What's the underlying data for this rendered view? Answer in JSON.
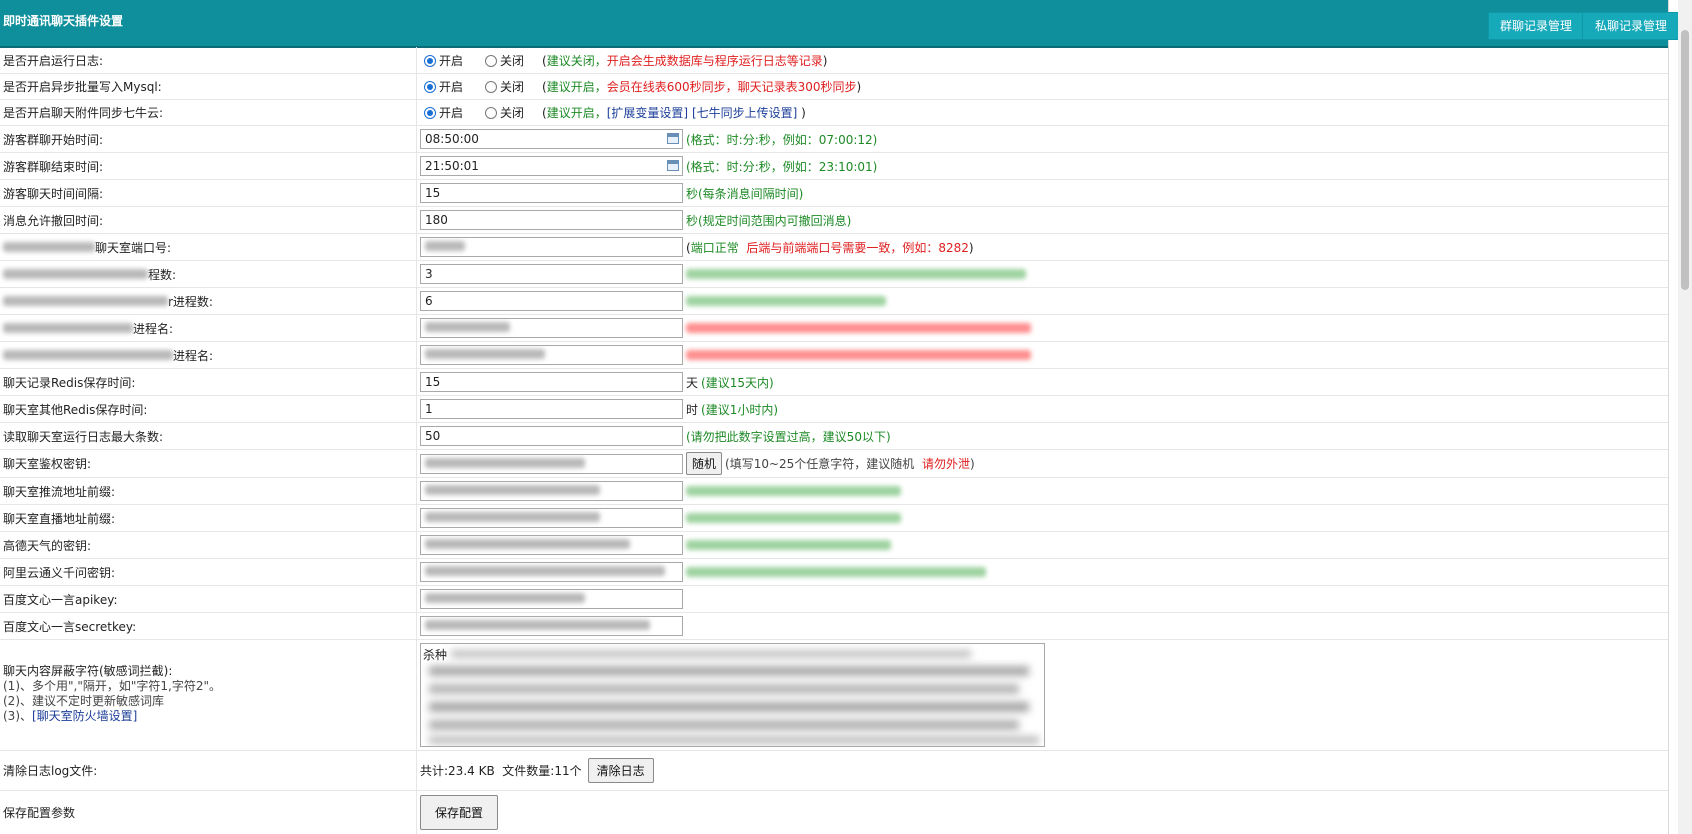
{
  "header": {
    "title": "即时通讯聊天插件设置",
    "btn_group": "群聊记录管理",
    "btn_private": "私聊记录管理"
  },
  "rows": {
    "log": {
      "label": "是否开启运行日志:",
      "on": "开启",
      "off": "关闭",
      "note_open": "(",
      "note_green": "建议关闭，",
      "note_red": "开启会生成数据库与程序运行日志等记录",
      "note_close": ")"
    },
    "mysql": {
      "label": "是否开启异步批量写入Mysql:",
      "on": "开启",
      "off": "关闭",
      "note_open": "(",
      "note_green": "建议开启，",
      "note_red": "会员在线表600秒同步，聊天记录表300秒同步",
      "note_close": ")"
    },
    "qiniu": {
      "label": "是否开启聊天附件同步七牛云:",
      "on": "开启",
      "off": "关闭",
      "note_open": "(",
      "note_green": "建议开启，",
      "link1": "[扩展变量设置]",
      "link2": "[七牛同步上传设置]",
      "note_close": ")"
    },
    "start": {
      "label": "游客群聊开始时间:",
      "value": "08:50:00",
      "note": "(格式：时:分:秒，例如：07:00:12)"
    },
    "end": {
      "label": "游客群聊结束时间:",
      "value": "21:50:01",
      "note": "(格式：时:分:秒，例如：23:10:01)"
    },
    "interval": {
      "label": "游客聊天时间间隔:",
      "value": "15",
      "note": "秒(每条消息间隔时间)"
    },
    "recall": {
      "label": "消息允许撤回时间:",
      "value": "180",
      "note": "秒(规定时间范围内可撤回消息)"
    },
    "port": {
      "label_suffix": "聊天室端口号:",
      "note_open": "(",
      "note_green": "端口正常",
      "note_red": "后端与前端端口号需要一致，例如：8282",
      "note_close": ")"
    },
    "proc1": {
      "label_suffix": "程数:",
      "value": "3"
    },
    "proc2": {
      "label_suffix": "r进程数:",
      "value": "6"
    },
    "proc3": {
      "label_suffix": "进程名:"
    },
    "proc4": {
      "label_suffix": "进程名:"
    },
    "redis_save": {
      "label": "聊天记录Redis保存时间:",
      "value": "15",
      "unit": "天",
      "note": "(建议15天内)"
    },
    "redis_other": {
      "label": "聊天室其他Redis保存时间:",
      "value": "1",
      "unit": "时",
      "note": "(建议1小时内)"
    },
    "log_max": {
      "label": "读取聊天室运行日志最大条数:",
      "value": "50",
      "note": "(请勿把此数字设置过高，建议50以下)"
    },
    "auth": {
      "label": "聊天室鉴权密钥:",
      "btn": "随机",
      "note_gray": "(填写10~25个任意字符，建议随机",
      "note_red": "请勿外泄",
      "note_close": ")"
    },
    "push": {
      "label": "聊天室推流地址前缀:"
    },
    "live": {
      "label": "聊天室直播地址前缀:"
    },
    "amap": {
      "label": "高德天气的密钥:"
    },
    "aliyun": {
      "label": "阿里云通义千问密钥:"
    },
    "baidu_api": {
      "label": "百度文心一言apikey:"
    },
    "baidu_secret": {
      "label": "百度文心一言secretkey:"
    },
    "filter": {
      "label": "聊天内容屏蔽字符(敏感词拦截):",
      "hint1": "(1)、多个用\",\"隔开，如\"字符1,字符2\"。",
      "hint2": "(2)、建议不定时更新敏感词库",
      "hint3_prefix": "(3)、",
      "hint3_link": "[聊天室防火墙设置]",
      "text_start": "杀种"
    },
    "clearlog": {
      "label": "清除日志log文件:",
      "total": "共计:23.4 KB  文件数量:11个",
      "btn": "清除日志"
    },
    "save": {
      "label": "保存配置参数",
      "btn": "保存配置"
    }
  },
  "colors": {
    "header_bg": "#0f8f9c",
    "header_btn": "#16a9ba",
    "green": "#1d8a25",
    "red": "#e02020",
    "link": "#1d3f9a"
  }
}
